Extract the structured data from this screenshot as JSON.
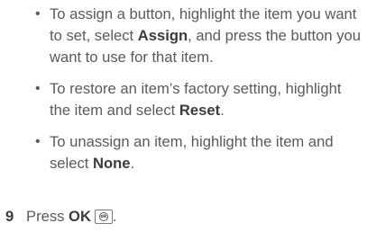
{
  "bullets": [
    {
      "bullet": "•",
      "parts": [
        {
          "text": "To assign a button, highlight the item you want to set, select ",
          "bold": false
        },
        {
          "text": "Assign",
          "bold": true
        },
        {
          "text": ", and press the button you want to use for that item.",
          "bold": false
        }
      ]
    },
    {
      "bullet": "•",
      "parts": [
        {
          "text": "To restore an item’s factory setting, highlight the item and select ",
          "bold": false
        },
        {
          "text": "Reset",
          "bold": true
        },
        {
          "text": ".",
          "bold": false
        }
      ]
    },
    {
      "bullet": "•",
      "parts": [
        {
          "text": "To unassign an item, highlight the item and select ",
          "bold": false
        },
        {
          "text": "None",
          "bold": true
        },
        {
          "text": ".",
          "bold": false
        }
      ]
    }
  ],
  "step": {
    "number": "9",
    "text": "Press ",
    "key_label": "OK",
    "key_icon": "ok-button-icon",
    "key_icon_glyph": "ok",
    "suffix": "."
  }
}
